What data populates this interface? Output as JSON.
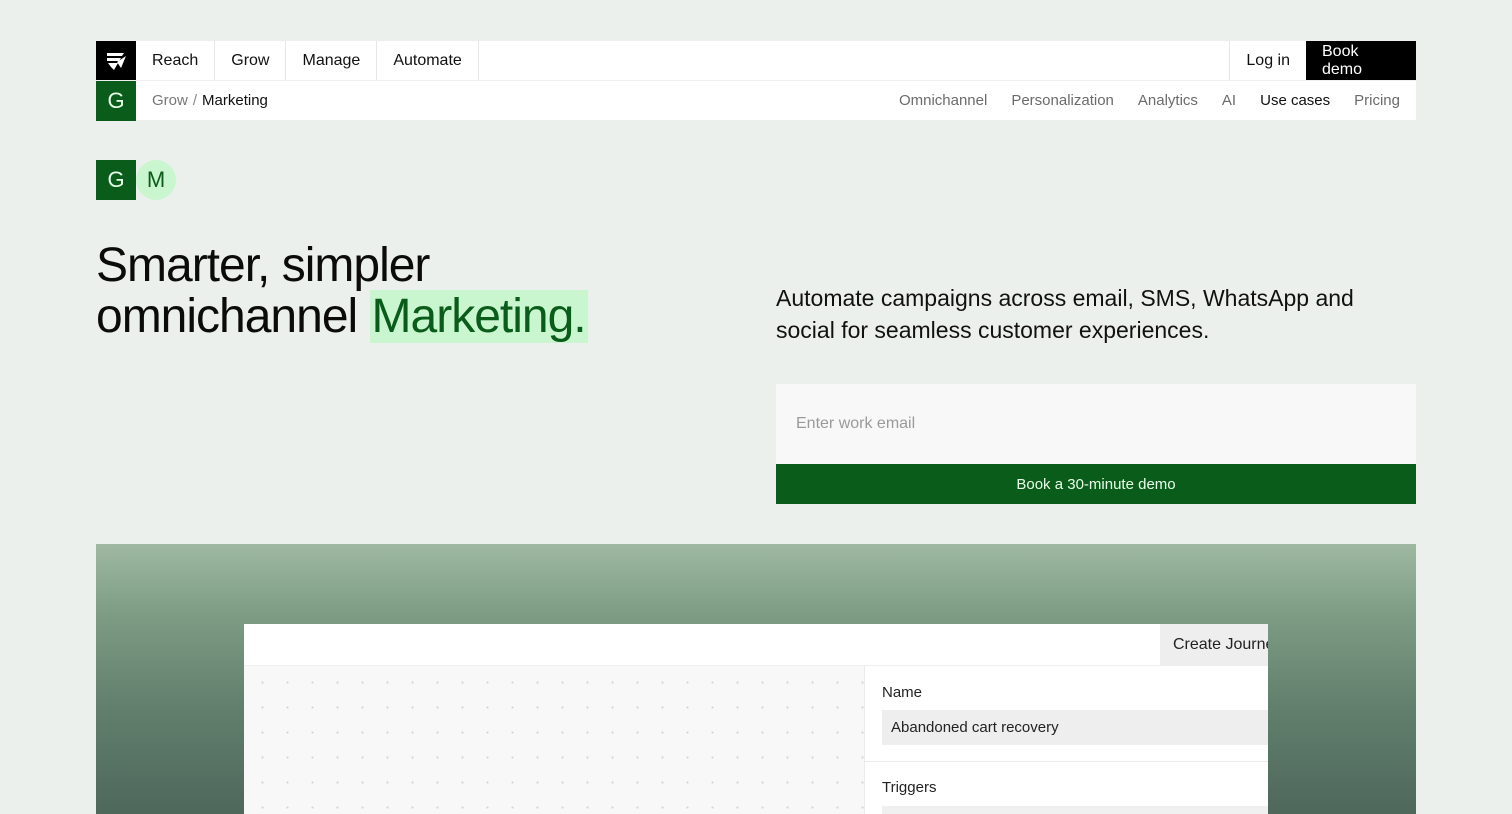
{
  "nav": {
    "logo_icon": "wings-logo-icon",
    "items": [
      {
        "label": "Reach"
      },
      {
        "label": "Grow"
      },
      {
        "label": "Manage"
      },
      {
        "label": "Automate"
      }
    ],
    "login_label": "Log in",
    "book_demo_label": "Book demo"
  },
  "subnav": {
    "section_letter": "G",
    "breadcrumb": {
      "parent": "Grow",
      "separator": "/",
      "current": "Marketing"
    },
    "links": [
      {
        "label": "Omnichannel"
      },
      {
        "label": "Personalization"
      },
      {
        "label": "Analytics"
      },
      {
        "label": "AI"
      },
      {
        "label": "Use cases"
      },
      {
        "label": "Pricing"
      }
    ],
    "active_link": "Use cases"
  },
  "badges": {
    "primary": "G",
    "secondary": "M"
  },
  "hero": {
    "headline_line1": "Smarter, simpler",
    "headline_line2": "omnichannel",
    "headline_highlight": "Marketing.",
    "subcopy": "Automate campaigns across email, SMS, WhatsApp and social for seamless customer experiences.",
    "email_placeholder": "Enter work email",
    "email_value": "",
    "cta_label": "Book a 30-minute demo"
  },
  "showcase": {
    "create_button": "Create Journey",
    "name_label": "Name",
    "name_value": "Abandoned cart recovery",
    "triggers_label": "Triggers"
  },
  "colors": {
    "page_bg": "#ecf0ec",
    "brand_green": "#0a5c1a",
    "highlight_green": "#c9f5cf",
    "black": "#000000"
  }
}
